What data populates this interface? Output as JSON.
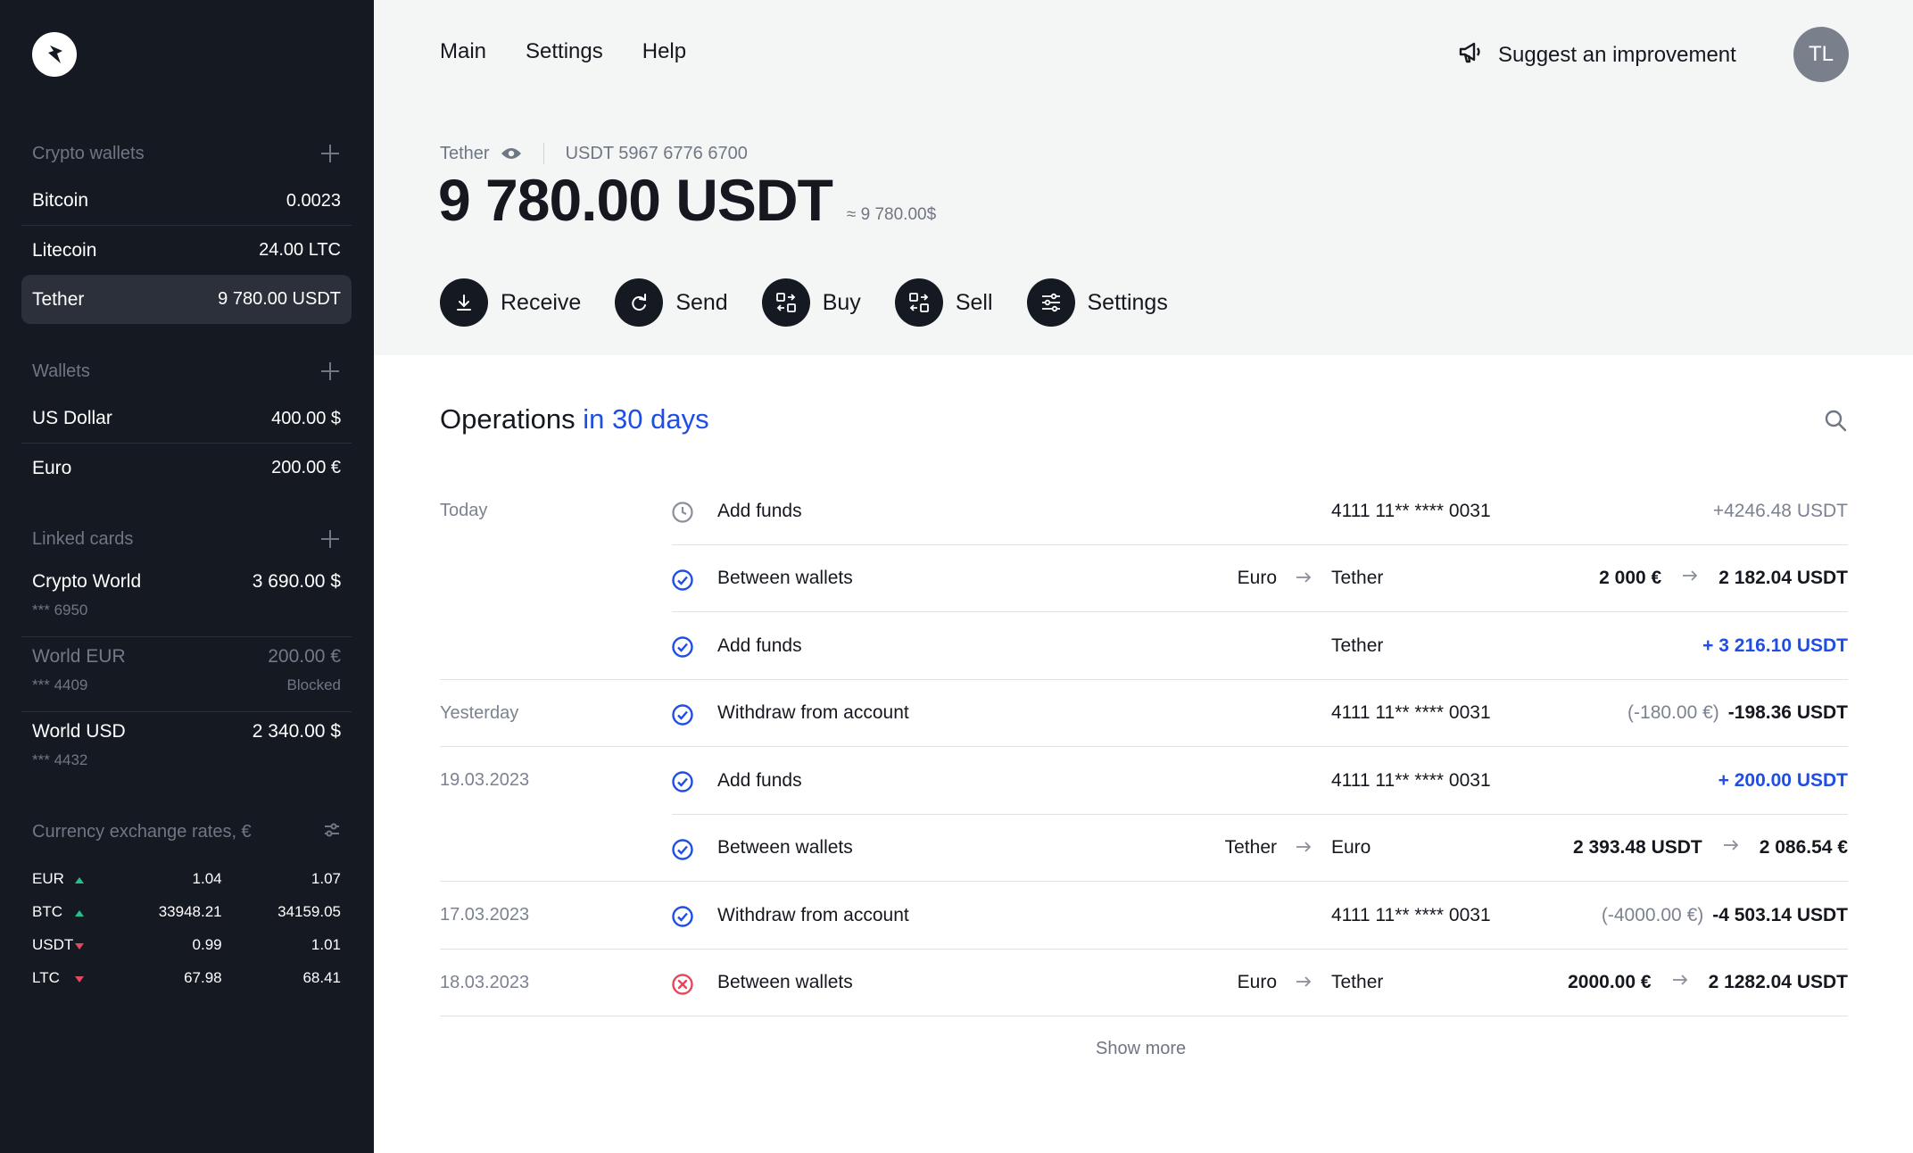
{
  "sidebar": {
    "crypto_wallets": {
      "title": "Crypto wallets",
      "items": [
        {
          "name": "Bitcoin",
          "value": "0.0023"
        },
        {
          "name": "Litecoin",
          "value": "24.00 LTC"
        },
        {
          "name": "Tether",
          "value": "9 780.00 USDT"
        }
      ]
    },
    "wallets": {
      "title": "Wallets",
      "items": [
        {
          "name": "US Dollar",
          "value": "400.00 $"
        },
        {
          "name": "Euro",
          "value": "200.00 €"
        }
      ]
    },
    "linked_cards": {
      "title": "Linked cards",
      "items": [
        {
          "name": "Crypto World",
          "value": "3 690.00 $",
          "number": "*** 6950",
          "status": ""
        },
        {
          "name": "World EUR",
          "value": "200.00 €",
          "number": "*** 4409",
          "status": "Blocked"
        },
        {
          "name": "World USD",
          "value": "2 340.00 $",
          "number": "*** 4432",
          "status": ""
        }
      ]
    },
    "rates": {
      "title": "Currency exchange rates, €",
      "items": [
        {
          "currency": "EUR",
          "trend": "up",
          "buy": "1.04",
          "sell": "1.07"
        },
        {
          "currency": "BTC",
          "trend": "up",
          "buy": "33948.21",
          "sell": "34159.05"
        },
        {
          "currency": "USDT",
          "trend": "down",
          "buy": "0.99",
          "sell": "1.01"
        },
        {
          "currency": "LTC",
          "trend": "down",
          "buy": "67.98",
          "sell": "68.41"
        }
      ]
    }
  },
  "nav": {
    "main": "Main",
    "settings": "Settings",
    "help": "Help"
  },
  "suggest": "Suggest an improvement",
  "avatar": "TL",
  "account": {
    "name": "Tether",
    "number": "USDT 5967 6776 6700",
    "balance": "9 780.00 USDT",
    "approx": "≈ 9 780.00$"
  },
  "actions": {
    "receive": "Receive",
    "send": "Send",
    "buy": "Buy",
    "sell": "Sell",
    "settings": "Settings"
  },
  "operations": {
    "title": "Operations",
    "period": "in 30 days",
    "show_more": "Show more",
    "rows": [
      {
        "date": "Today",
        "status": "pending",
        "name": "Add funds",
        "from": "",
        "dest": "4111 11** **** 0031",
        "amount_a": "",
        "amount_b": "+4246.48 USDT"
      },
      {
        "date": "",
        "status": "done",
        "name": "Between wallets",
        "from": "Euro",
        "dest": "Tether",
        "amount_a": "2 000 €",
        "amount_b": "2 182.04 USDT"
      },
      {
        "date": "",
        "status": "done",
        "name": "Add funds",
        "from": "",
        "dest": "Tether",
        "amount_a": "",
        "amount_b": "+ 3 216.10 USDT"
      },
      {
        "date": "Yesterday",
        "status": "done",
        "name": "Withdraw from account",
        "from": "",
        "dest": "4111 11** **** 0031",
        "amount_a": "(-180.00 €)",
        "amount_b": "-198.36 USDT"
      },
      {
        "date": "19.03.2023",
        "status": "done",
        "name": "Add funds",
        "from": "",
        "dest": "4111 11** **** 0031",
        "amount_a": "",
        "amount_b": "+ 200.00 USDT"
      },
      {
        "date": "",
        "status": "done",
        "name": "Between wallets",
        "from": "Tether",
        "dest": "Euro",
        "amount_a": "2 393.48 USDT",
        "amount_b": "2 086.54 €"
      },
      {
        "date": "17.03.2023",
        "status": "done",
        "name": "Withdraw from account",
        "from": "",
        "dest": "4111 11** **** 0031",
        "amount_a": "(-4000.00 €)",
        "amount_b": "-4 503.14 USDT"
      },
      {
        "date": "18.03.2023",
        "status": "failed",
        "name": "Between wallets",
        "from": "Euro",
        "dest": "Tether",
        "amount_a": "2000.00 €",
        "amount_b": "2 1282.04 USDT"
      }
    ]
  },
  "colors": {
    "accent": "#1f4ee6",
    "sidebar": "#151922",
    "up": "#27c08a",
    "down": "#e5475c"
  }
}
